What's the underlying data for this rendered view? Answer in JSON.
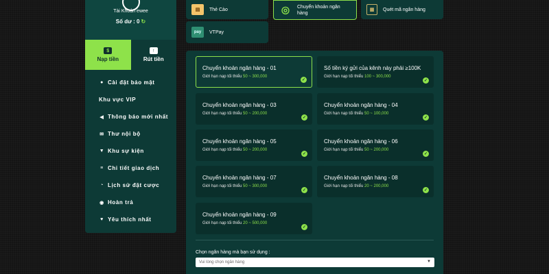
{
  "profile": {
    "account_label": "Tài Khoản ewee",
    "balance_label": "Số dư : 0"
  },
  "tabs": [
    {
      "label": "Nạp tiền",
      "icon": "deposit-icon",
      "active": true
    },
    {
      "label": "Rút tiền",
      "icon": "withdraw-icon",
      "active": false
    }
  ],
  "menu": [
    {
      "label": "Cài đặt bảo mật",
      "icon": "user-shield-icon"
    },
    {
      "label": "Khu vực VIP",
      "icon": ""
    },
    {
      "label": "Thông báo mới nhất",
      "icon": "megaphone-icon"
    },
    {
      "label": "Thư nội bộ",
      "icon": "envelope-icon"
    },
    {
      "label": "Khu sự kiện",
      "icon": "trophy-icon"
    },
    {
      "label": "Chi tiết giao dịch",
      "icon": "list-icon"
    },
    {
      "label": "Lịch sử đặt cược",
      "icon": "history-icon"
    },
    {
      "label": "Hoàn trả",
      "icon": "refund-icon"
    },
    {
      "label": "Yêu thích nhất",
      "icon": "heart-icon"
    }
  ],
  "methods": [
    {
      "label": "Thẻ Cào",
      "icon": "card-icon",
      "selected": false
    },
    {
      "label": "Chuyển khoản ngân hàng",
      "icon": "globe-icon",
      "selected": true
    },
    {
      "label": "Quét mã ngân hàng",
      "icon": "qr-icon",
      "selected": false
    },
    {
      "label": "VTPay",
      "icon": "vtpay-logo",
      "selected": false
    }
  ],
  "banks": [
    {
      "name": "Chuyển khoản ngân hàng - 01",
      "limit_label": "Giới hạn nạp tối thiểu",
      "range": "50 ~ 300,000",
      "selected": true
    },
    {
      "name": "Số tiền ký gửi của kênh này phải ≥100K",
      "limit_label": "Giới hạn nạp tối thiểu",
      "range": "100 ~ 300,000",
      "selected": false
    },
    {
      "name": "Chuyển khoản ngân hàng - 03",
      "limit_label": "Giới hạn nạp tối thiểu",
      "range": "50 ~ 200,000",
      "selected": false
    },
    {
      "name": "Chuyển khoản ngân hàng - 04",
      "limit_label": "Giới hạn nạp tối thiểu",
      "range": "50 ~ 100,000",
      "selected": false
    },
    {
      "name": "Chuyển khoản ngân hàng - 05",
      "limit_label": "Giới hạn nạp tối thiểu",
      "range": "50 ~ 200,000",
      "selected": false
    },
    {
      "name": "Chuyển khoản ngân hàng - 06",
      "limit_label": "Giới hạn nạp tối thiểu",
      "range": "50 ~ 200,000",
      "selected": false
    },
    {
      "name": "Chuyển khoản ngân hàng - 07",
      "limit_label": "Giới hạn nạp tối thiểu",
      "range": "50 ~ 300,000",
      "selected": false
    },
    {
      "name": "Chuyển khoản ngân hàng - 08",
      "limit_label": "Giới hạn nạp tối thiểu",
      "range": "20 ~ 200,000",
      "selected": false
    },
    {
      "name": "Chuyển khoản ngân hàng - 09",
      "limit_label": "Giới hạn nạp tối thiểu",
      "range": "20 ~ 500,000",
      "selected": false
    }
  ],
  "bank_select": {
    "label": "Chọn ngân hàng mà bạn sử dụng :",
    "placeholder": "Vui lòng chọn ngân hàng"
  },
  "colors": {
    "accent": "#8ee24a",
    "panel": "#0d3a36",
    "card": "#0a2f2b"
  }
}
